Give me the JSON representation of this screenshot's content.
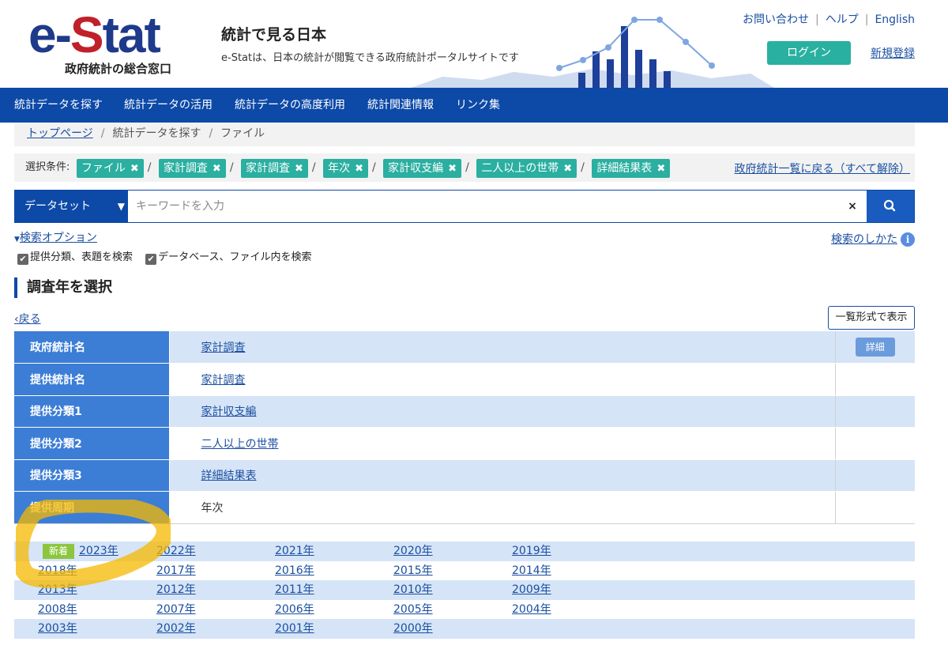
{
  "header": {
    "logo_text_e": "e-",
    "logo_text_s": "S",
    "logo_text_rest": "tat",
    "logo_sub": "政府統計の総合窓口",
    "site_title": "統計で見る日本",
    "site_desc": "e-Statは、日本の統計が閲覧できる政府統計ポータルサイトです",
    "links": [
      "お問い合わせ",
      "ヘルプ",
      "English"
    ],
    "login": "ログイン",
    "register": "新規登録"
  },
  "nav": [
    "統計データを探す",
    "統計データの活用",
    "統計データの高度利用",
    "統計関連情報",
    "リンク集"
  ],
  "breadcrumb": [
    "トップページ",
    "統計データを探す",
    "ファイル"
  ],
  "conditions": {
    "label": "選択条件:",
    "tags": [
      "ファイル",
      "家計調査",
      "家計調査",
      "年次",
      "家計収支編",
      "二人以上の世帯",
      "詳細結果表"
    ],
    "reset": "政府統計一覧に戻る（すべて解除）"
  },
  "search": {
    "select": "データセット",
    "placeholder": "キーワードを入力",
    "clear": "×",
    "options": "検索オプション",
    "howto": "検索のしかた",
    "checks": [
      "提供分類、表題を検索",
      "データベース、ファイル内を検索"
    ]
  },
  "section": {
    "title": "調査年を選択",
    "back": "戻る",
    "list_button": "一覧形式で表示"
  },
  "info_rows": [
    {
      "label": "政府統計名",
      "value": "家計調査",
      "link": true
    },
    {
      "label": "提供統計名",
      "value": "家計調査",
      "link": true
    },
    {
      "label": "提供分類1",
      "value": "家計収支編",
      "link": true
    },
    {
      "label": "提供分類2",
      "value": "二人以上の世帯",
      "link": true
    },
    {
      "label": "提供分類3",
      "value": "詳細結果表",
      "link": true
    },
    {
      "label": "提供周期",
      "value": "年次",
      "link": false
    }
  ],
  "detail_button": "詳細",
  "new_badge": "新着",
  "years": [
    [
      "2023年",
      "2022年",
      "2021年",
      "2020年",
      "2019年"
    ],
    [
      "2018年",
      "2017年",
      "2016年",
      "2015年",
      "2014年"
    ],
    [
      "2013年",
      "2012年",
      "2011年",
      "2010年",
      "2009年"
    ],
    [
      "2008年",
      "2007年",
      "2006年",
      "2005年",
      "2004年"
    ],
    [
      "2003年",
      "2002年",
      "2001年",
      "2000年"
    ]
  ],
  "colors": {
    "nav": "#0d49a7",
    "tag": "#2aafa0",
    "table_header": "#3c7dd6",
    "row_shade": "#d6e4f7",
    "new_badge": "#8cc63f",
    "highlight": "#f5b800"
  }
}
